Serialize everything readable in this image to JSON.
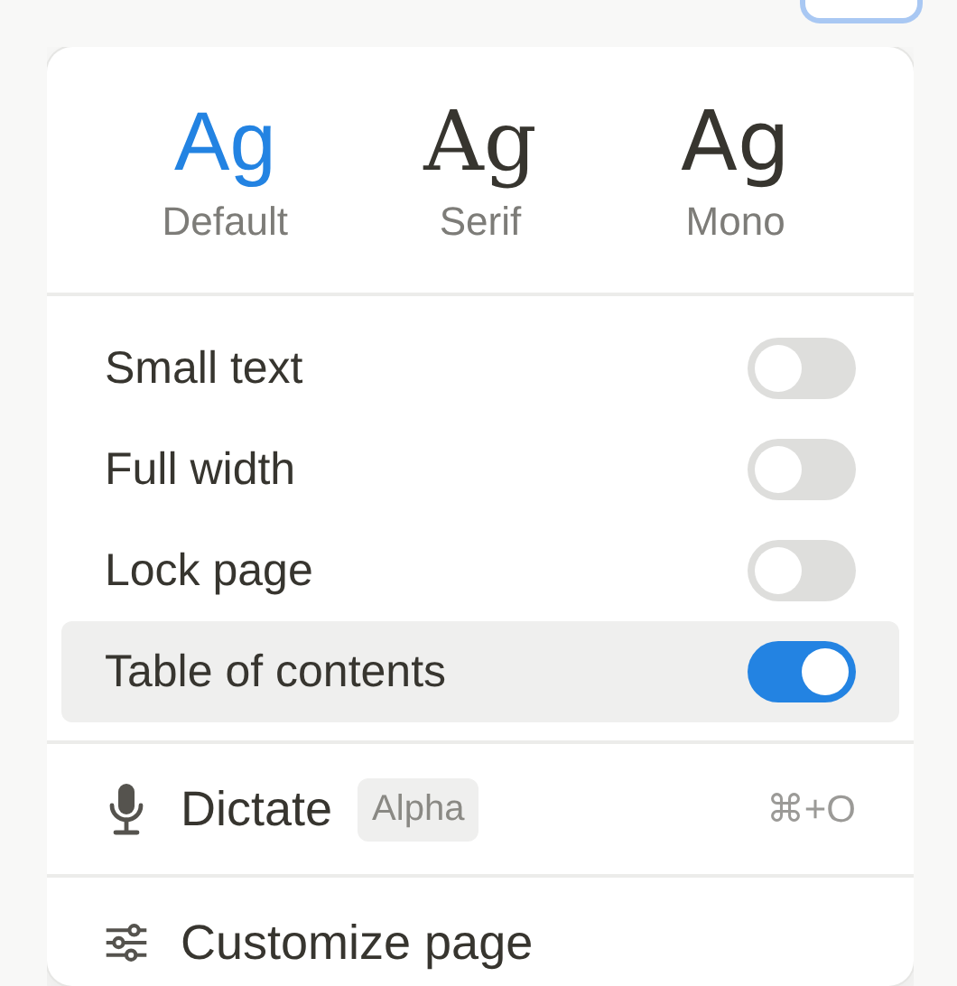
{
  "fonts": [
    {
      "sample": "Ag",
      "label": "Default",
      "kind": "sans",
      "selected": true
    },
    {
      "sample": "Ag",
      "label": "Serif",
      "kind": "serif",
      "selected": false
    },
    {
      "sample": "Ag",
      "label": "Mono",
      "kind": "mono",
      "selected": false
    }
  ],
  "toggles": [
    {
      "label": "Small text",
      "on": false,
      "selected": false
    },
    {
      "label": "Full width",
      "on": false,
      "selected": false
    },
    {
      "label": "Lock page",
      "on": false,
      "selected": false
    },
    {
      "label": "Table of contents",
      "on": true,
      "selected": true
    }
  ],
  "actions": [
    {
      "label": "Dictate",
      "kind": "mic",
      "badge": "Alpha",
      "shortcut": "⌘+O"
    },
    {
      "label": "Customize page",
      "kind": "sliders"
    }
  ]
}
